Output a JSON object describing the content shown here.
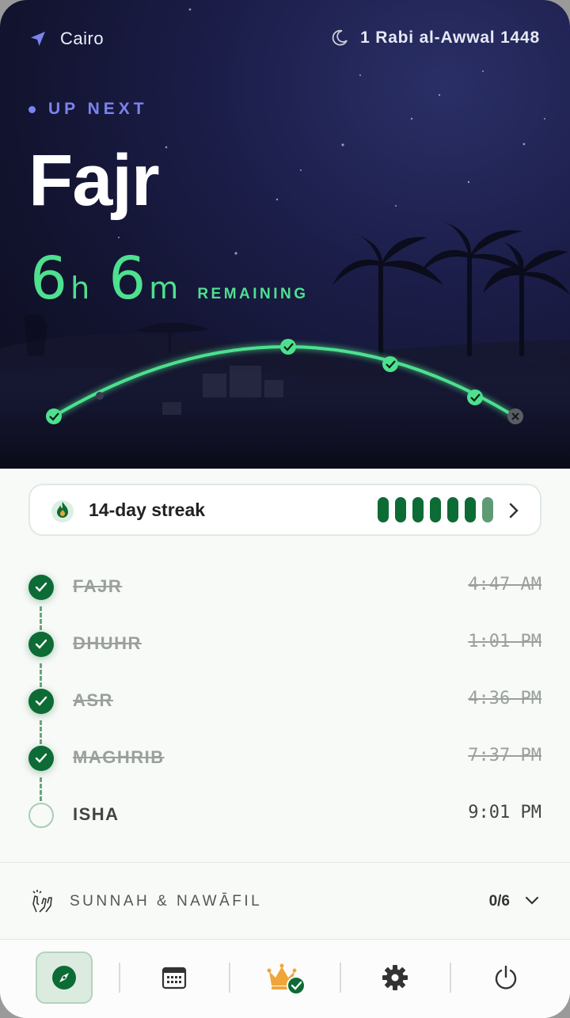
{
  "header": {
    "location": "Cairo",
    "hijri_date": "1 Rabi al-Awwal 1448"
  },
  "hero": {
    "up_next_label": "UP NEXT",
    "next_prayer": "Fajr",
    "hours": "6",
    "hours_unit": "h",
    "minutes": "6",
    "minutes_unit": "m",
    "remaining_label": "REMAINING"
  },
  "streak": {
    "label": "14-day streak",
    "segments_full": 6,
    "segments_partial": 1
  },
  "prayers": [
    {
      "name": "FAJR",
      "time": "4:47 AM",
      "done": true
    },
    {
      "name": "DHUHR",
      "time": "1:01 PM",
      "done": true
    },
    {
      "name": "ASR",
      "time": "4:36 PM",
      "done": true
    },
    {
      "name": "MAGHRIB",
      "time": "7:37 PM",
      "done": true
    },
    {
      "name": "ISHA",
      "time": "9:01 PM",
      "done": false
    }
  ],
  "sunnah": {
    "label": "SUNNAH & NAWĀFIL",
    "count": "0/6"
  },
  "nav": {
    "items": [
      "compass-icon",
      "calendar-icon",
      "crown-icon",
      "gear-icon",
      "power-icon"
    ],
    "active": "compass-icon"
  },
  "colors": {
    "accent_green": "#4ee08f",
    "done_green": "#0d6b35",
    "up_next_purple": "#7b83ef"
  }
}
